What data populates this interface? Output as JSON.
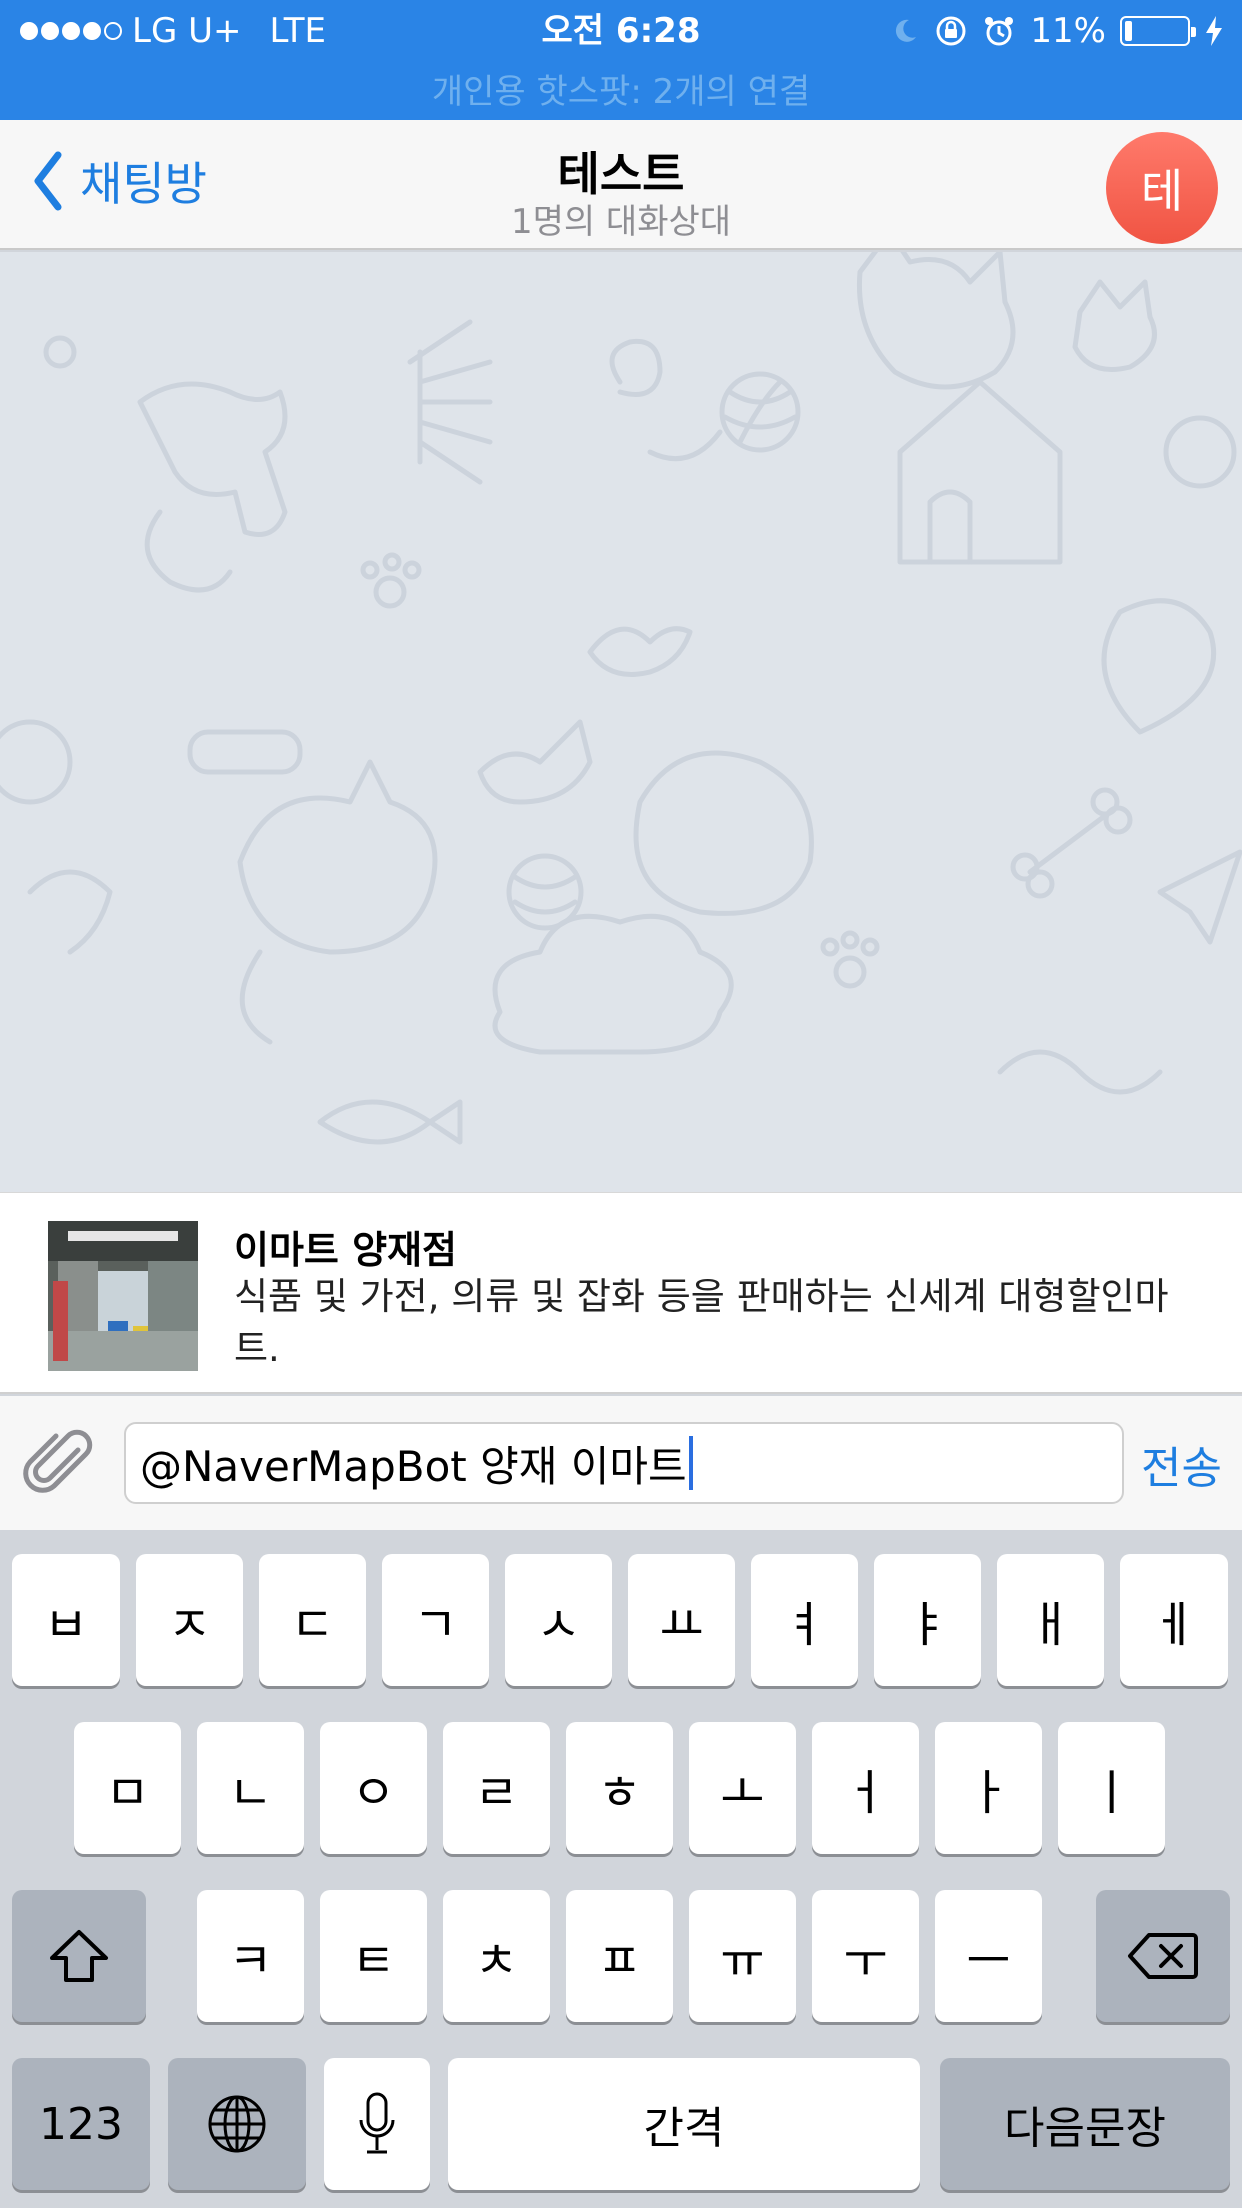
{
  "status_bar": {
    "carrier": "LG U+",
    "network": "LTE",
    "time": "오전 6:28",
    "battery": "11%",
    "battery_level": 0.11,
    "signal_bars_filled": 4,
    "signal_bars_total": 5,
    "icons": [
      "moon-icon",
      "rotation-lock-icon",
      "alarm-icon",
      "battery-icon",
      "charging-bolt-icon"
    ]
  },
  "hotspot_banner": "개인용 핫스팟: 2개의 연결",
  "nav": {
    "back_label": "채팅방",
    "title": "테스트",
    "subtitle": "1명의 대화상대",
    "avatar_initial": "테"
  },
  "result": {
    "title": "이마트 양재점",
    "description": "식품 및 가전, 의류 및 잡화 등을 판매하는 신세계 대형할인마트."
  },
  "input": {
    "value": "@NaverMapBot 양재 이마트",
    "send_label": "전송"
  },
  "keyboard": {
    "row1": [
      "ㅂ",
      "ㅈ",
      "ㄷ",
      "ㄱ",
      "ㅅ",
      "ㅛ",
      "ㅕ",
      "ㅑ",
      "ㅐ",
      "ㅔ"
    ],
    "row2": [
      "ㅁ",
      "ㄴ",
      "ㅇ",
      "ㄹ",
      "ㅎ",
      "ㅗ",
      "ㅓ",
      "ㅏ",
      "ㅣ"
    ],
    "row3": [
      "ㅋ",
      "ㅌ",
      "ㅊ",
      "ㅍ",
      "ㅠ",
      "ㅜ",
      "ㅡ"
    ],
    "numbers_label": "123",
    "space_label": "간격",
    "return_label": "다음문장"
  },
  "colors": {
    "status_bar": "#2a84e6",
    "accent": "#1e7ee0",
    "avatar": "#f05443",
    "chat_background": "#dfe4ea"
  }
}
